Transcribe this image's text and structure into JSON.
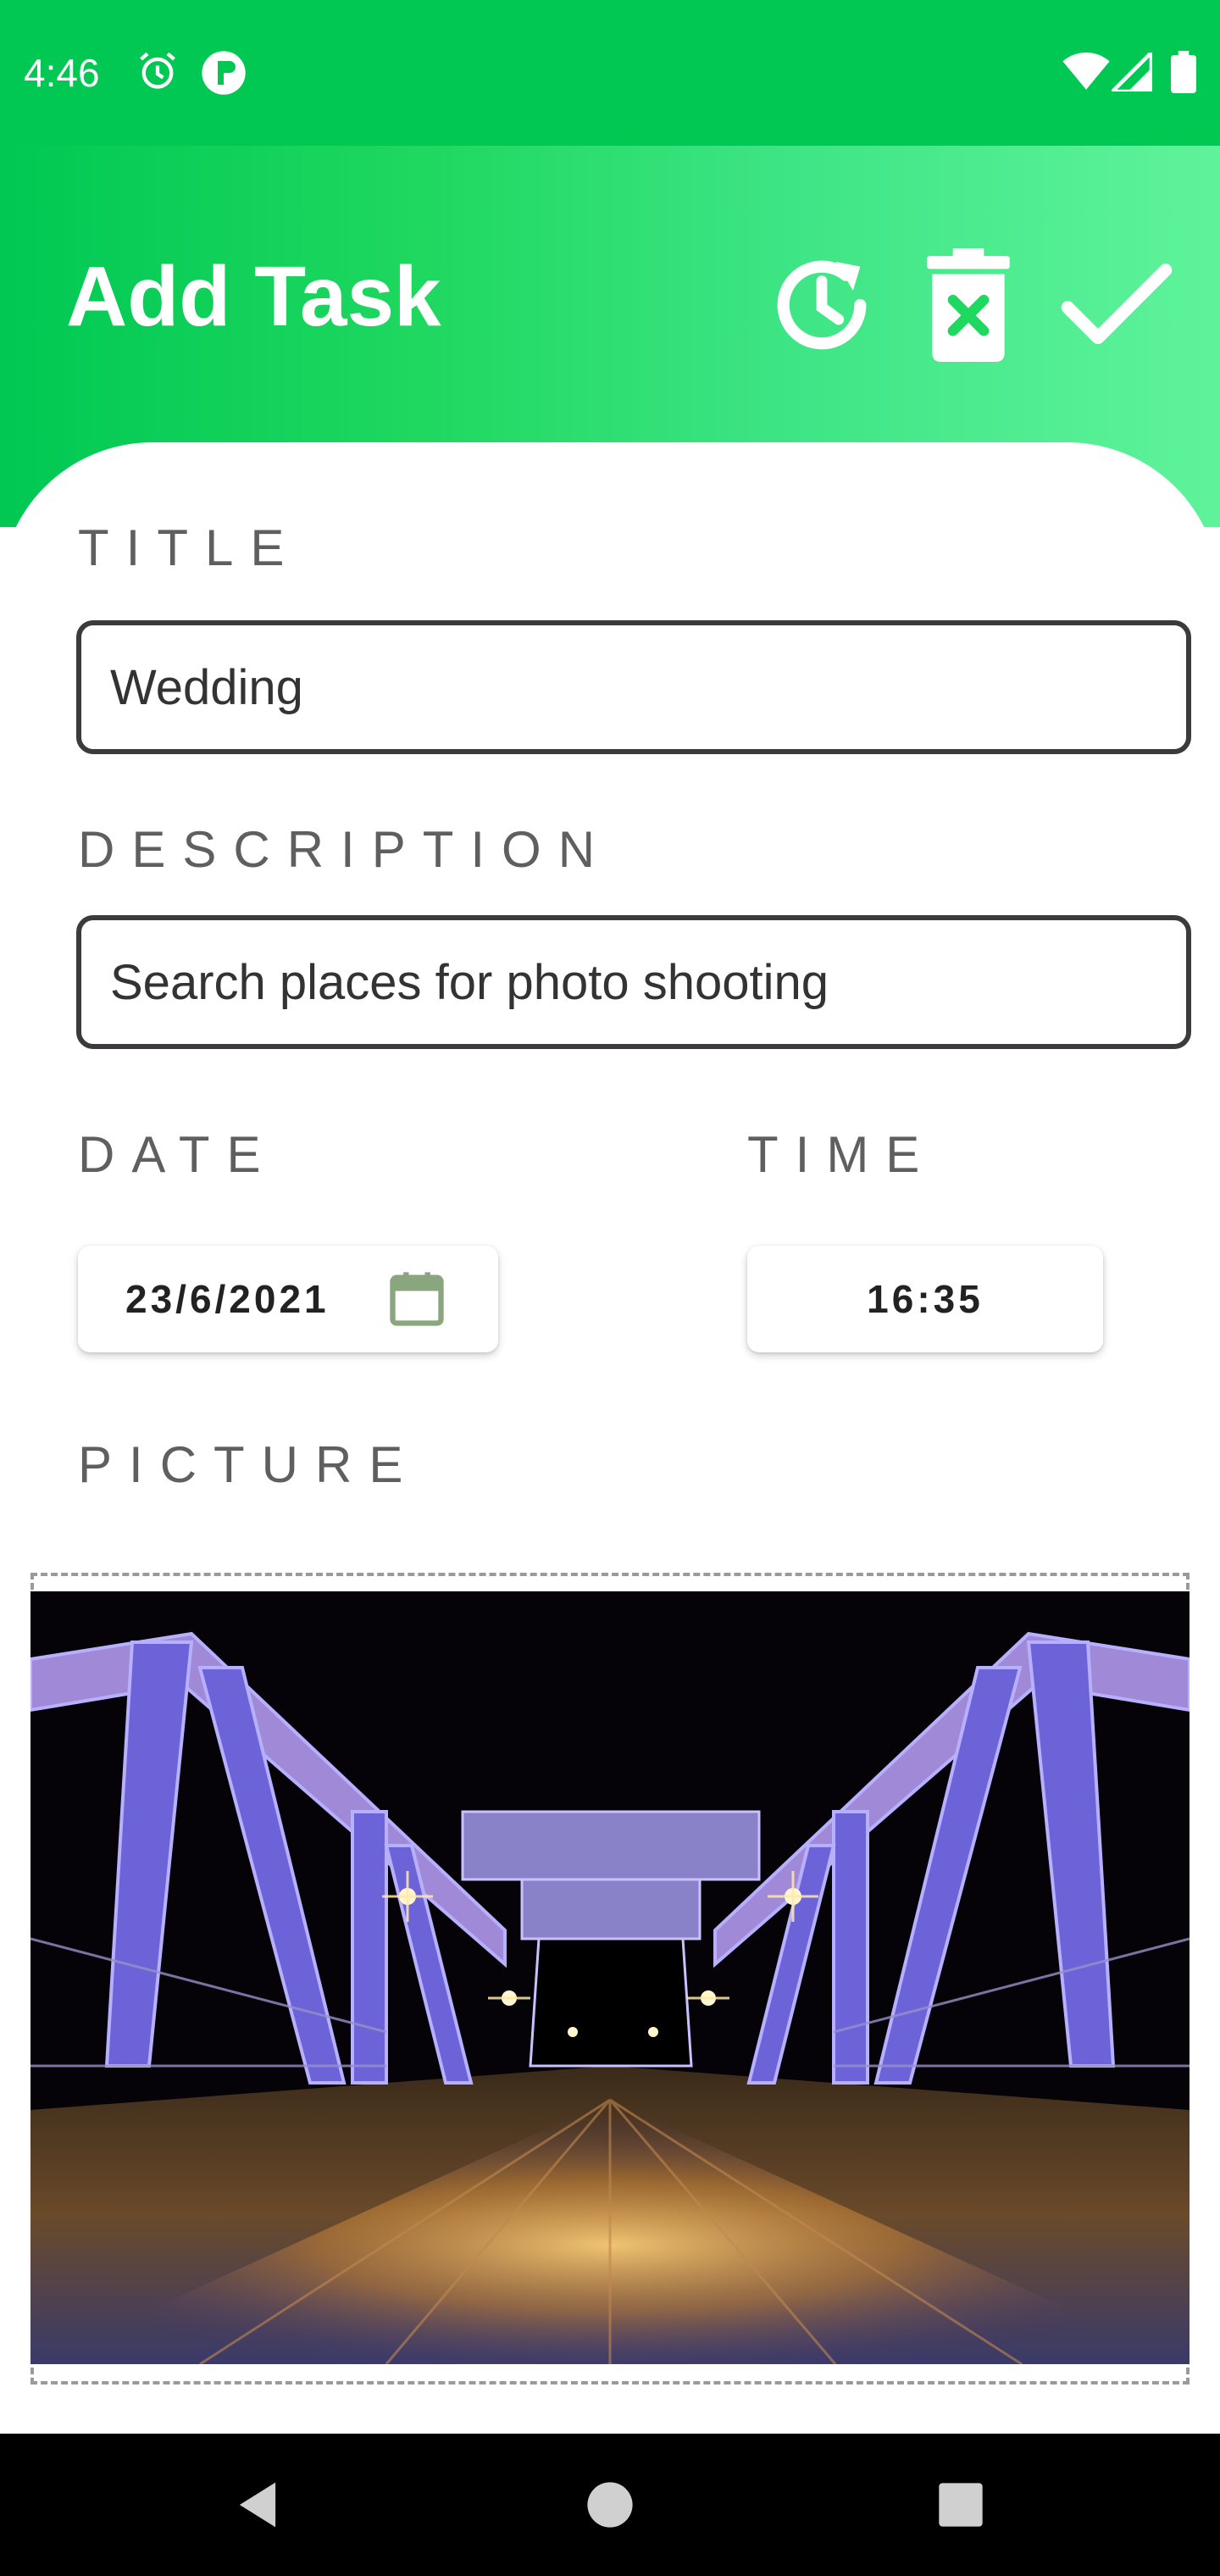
{
  "status_bar": {
    "time": "4:46",
    "icons": [
      "alarm-icon",
      "app-notification-icon",
      "wifi-icon",
      "signal-icon",
      "battery-icon"
    ],
    "bg_color": "#00c853"
  },
  "app_bar": {
    "title": "Add Task",
    "actions": [
      "reset-time-icon",
      "delete-icon",
      "check-icon"
    ],
    "gradient": [
      "#00c853",
      "#5ff39b"
    ]
  },
  "form": {
    "title_label": "TITLE",
    "title_value": "Wedding",
    "description_label": "DESCRIPTION",
    "description_value": "Search places for photo shooting",
    "date_label": "DATE",
    "date_value": "23/6/2021",
    "time_label": "TIME",
    "time_value": "16:35",
    "picture_label": "PICTURE"
  },
  "nav_bar": {
    "buttons": [
      "back-icon",
      "home-icon",
      "recents-icon"
    ]
  }
}
